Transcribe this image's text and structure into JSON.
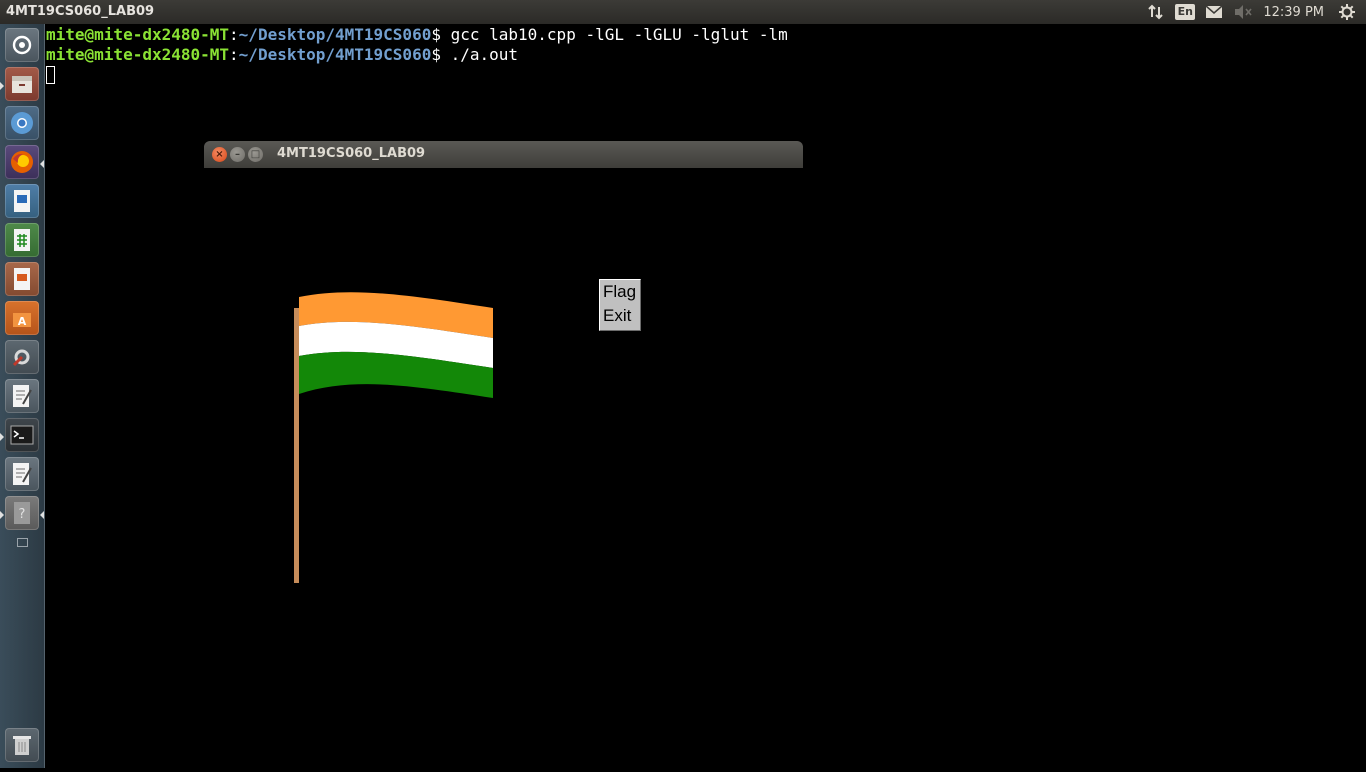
{
  "top_panel": {
    "window_title": "4MT19CS060_LAB09",
    "lang": "En",
    "clock": "12:39 PM",
    "icons": [
      "network-icon",
      "keyboard-layout-icon",
      "mail-icon",
      "volume-muted-icon",
      "gear-icon"
    ]
  },
  "launcher": {
    "items": [
      "ubuntu-dash-icon",
      "files-icon",
      "chromium-icon",
      "firefox-icon",
      "writer-icon",
      "calc-icon",
      "impress-icon",
      "software-center-icon",
      "system-settings-icon",
      "text-editor-icon",
      "terminal-icon",
      "text-editor-icon",
      "help-icon",
      "trash-icon"
    ]
  },
  "terminal": {
    "lines": [
      {
        "user": "mite@mite-dx2480-MT",
        "sep": ":",
        "path": "~/Desktop/4MT19CS060",
        "prompt": "$ ",
        "cmd": "gcc lab10.cpp -lGL -lGLU -lglut -lm"
      },
      {
        "user": "mite@mite-dx2480-MT",
        "sep": ":",
        "path": "~/Desktop/4MT19CS060",
        "prompt": "$ ",
        "cmd": "./a.out"
      }
    ]
  },
  "glut_window": {
    "title": "4MT19CS060_LAB09",
    "close_glyph": "×",
    "min_glyph": "–",
    "max_glyph": "□",
    "menu_items": [
      "Flag",
      "Exit"
    ],
    "colors": {
      "saffron": "#ff9933",
      "white": "#ffffff",
      "green": "#138808",
      "pole": "#c68c5a"
    }
  }
}
